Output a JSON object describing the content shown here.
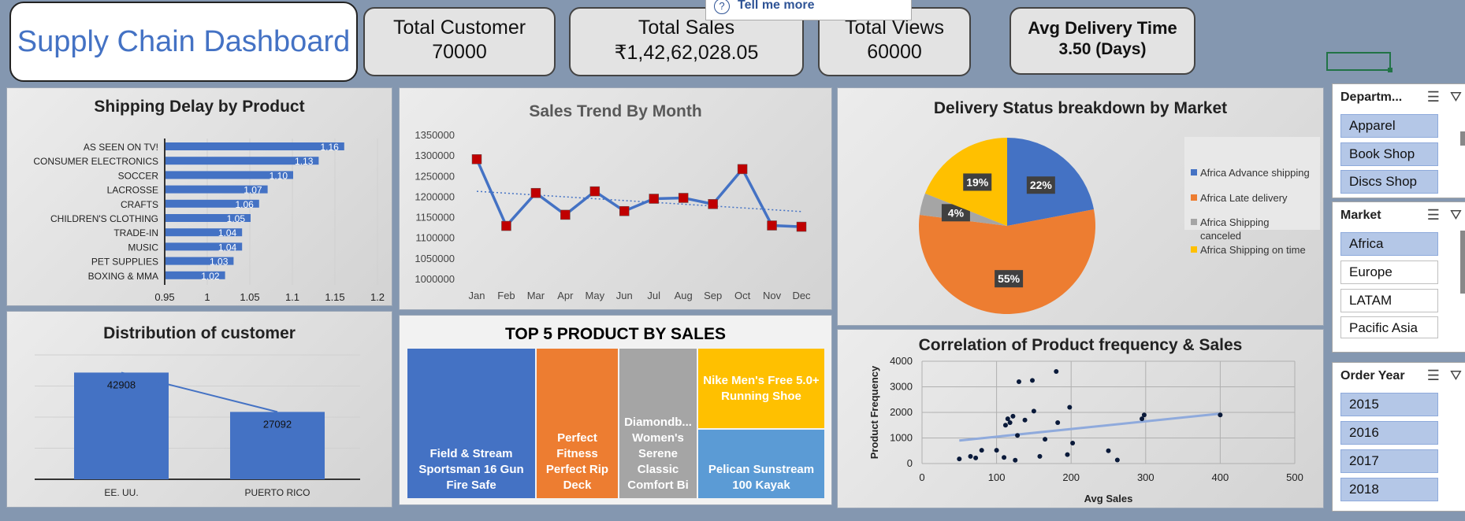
{
  "header": {
    "title": "Supply Chain Dashboard",
    "tell_me": "Tell me more"
  },
  "kpis": [
    {
      "label": "Total Customer",
      "value": "70000"
    },
    {
      "label": "Total Sales",
      "value": "₹1,42,62,028.05"
    },
    {
      "label": "Total Views",
      "value": "60000"
    },
    {
      "label": "Avg Delivery Time",
      "value": "3.50 (Days)"
    }
  ],
  "charts": {
    "shipping": {
      "title": "Shipping Delay by Product"
    },
    "sales": {
      "title": "Sales Trend By Month"
    },
    "delivery": {
      "title": "Delivery Status breakdown by Market"
    },
    "distribution": {
      "title": "Distribution of customer"
    },
    "top5": {
      "title": "TOP 5 PRODUCT BY SALES"
    },
    "correlation": {
      "title": "Correlation of Product frequency & Sales",
      "xlabel": "Avg Sales",
      "ylabel": "Product Frequency"
    }
  },
  "chart_data": [
    {
      "type": "bar",
      "orientation": "horizontal",
      "title": "Shipping Delay by Product",
      "categories": [
        "AS SEEN ON  TV!",
        "CONSUMER ELECTRONICS",
        "SOCCER",
        "LACROSSE",
        "CRAFTS",
        "CHILDREN'S CLOTHING",
        "TRADE-IN",
        "MUSIC",
        "PET SUPPLIES",
        "BOXING & MMA"
      ],
      "values": [
        1.16,
        1.13,
        1.1,
        1.07,
        1.06,
        1.05,
        1.04,
        1.04,
        1.03,
        1.02
      ],
      "labels": [
        "1.16",
        "1.13",
        "1.10",
        "1.07",
        "1.06",
        "1.05",
        "1.04",
        "1.04",
        "1.03",
        "1.02"
      ],
      "xlim": [
        0.95,
        1.2
      ],
      "xticks": [
        "0.95",
        "1",
        "1.05",
        "1.1",
        "1.15",
        "1.2"
      ],
      "grid": true,
      "color": "#4472c4"
    },
    {
      "type": "line",
      "title": "Sales Trend By Month",
      "categories": [
        "Jan",
        "Feb",
        "Mar",
        "Apr",
        "May",
        "Jun",
        "Jul",
        "Aug",
        "Sep",
        "Oct",
        "Nov",
        "Dec"
      ],
      "values": [
        1292000,
        1130000,
        1210000,
        1157000,
        1214000,
        1166000,
        1196000,
        1198000,
        1183000,
        1268000,
        1131000,
        1128000
      ],
      "ylim": [
        1000000,
        1350000
      ],
      "yticks": [
        "1000000",
        "1050000",
        "1100000",
        "1150000",
        "1200000",
        "1250000",
        "1300000",
        "1350000"
      ],
      "trendline": true,
      "line_color": "#4472c4",
      "marker_color": "#c00000"
    },
    {
      "type": "pie",
      "title": "Delivery Status breakdown by Market",
      "slices": [
        {
          "name": "Africa Advance shipping",
          "value": 22,
          "label": "22%",
          "color": "#4472c4"
        },
        {
          "name": "Africa Late delivery",
          "value": 55,
          "label": "55%",
          "color": "#ed7d31"
        },
        {
          "name": "Africa Shipping canceled",
          "value": 4,
          "label": "4%",
          "color": "#a5a5a5"
        },
        {
          "name": "Africa Shipping on time",
          "value": 19,
          "label": "19%",
          "color": "#ffc000"
        }
      ],
      "legend_placement": "right"
    },
    {
      "type": "bar",
      "title": "Distribution of customer",
      "categories": [
        "EE. UU.",
        "PUERTO RICO"
      ],
      "values": [
        42908,
        27092
      ],
      "labels": [
        "42908",
        "27092"
      ],
      "trendline": true,
      "color": "#4472c4"
    },
    {
      "type": "treemap",
      "title": "TOP 5 PRODUCT BY SALES",
      "items": [
        {
          "name": "Field & Stream Sportsman 16 Gun Fire Safe",
          "color": "#4472c4"
        },
        {
          "name": "Perfect Fitness Perfect Rip Deck",
          "color": "#ed7d31"
        },
        {
          "name": "Diamondb... Women's Serene Classic Comfort Bi",
          "color": "#a5a5a5"
        },
        {
          "name": "Nike Men's Free 5.0+ Running Shoe",
          "color": "#ffc000"
        },
        {
          "name": "Pelican Sunstream 100 Kayak",
          "color": "#5b9bd5"
        }
      ]
    },
    {
      "type": "scatter",
      "title": "Correlation of Product frequency & Sales",
      "xlabel": "Avg Sales",
      "ylabel": "Product Frequency",
      "xlim": [
        0,
        500
      ],
      "ylim": [
        0,
        4000
      ],
      "xticks": [
        "0",
        "100",
        "200",
        "300",
        "400",
        "500"
      ],
      "yticks": [
        "0",
        "1000",
        "2000",
        "3000",
        "4000"
      ],
      "trendline": {
        "x": [
          50,
          400
        ],
        "y": [
          900,
          1950
        ]
      },
      "points": [
        [
          50,
          180
        ],
        [
          65,
          280
        ],
        [
          72,
          220
        ],
        [
          80,
          520
        ],
        [
          100,
          520
        ],
        [
          110,
          240
        ],
        [
          112,
          1500
        ],
        [
          115,
          1750
        ],
        [
          118,
          1600
        ],
        [
          122,
          1850
        ],
        [
          125,
          130
        ],
        [
          128,
          1100
        ],
        [
          130,
          3200
        ],
        [
          138,
          1700
        ],
        [
          148,
          3250
        ],
        [
          150,
          2050
        ],
        [
          158,
          280
        ],
        [
          165,
          950
        ],
        [
          180,
          3600
        ],
        [
          182,
          1600
        ],
        [
          195,
          350
        ],
        [
          198,
          2200
        ],
        [
          202,
          800
        ],
        [
          250,
          500
        ],
        [
          262,
          140
        ],
        [
          295,
          1750
        ],
        [
          298,
          1900
        ],
        [
          400,
          1900
        ]
      ]
    }
  ],
  "slicers": {
    "department": {
      "header": "Departm...",
      "items": [
        {
          "label": "Apparel",
          "selected": true
        },
        {
          "label": "Book Shop",
          "selected": true
        },
        {
          "label": "Discs Shop",
          "selected": true
        }
      ]
    },
    "market": {
      "header": "Market",
      "items": [
        {
          "label": "Africa",
          "selected": true
        },
        {
          "label": "Europe",
          "selected": false
        },
        {
          "label": "LATAM",
          "selected": false
        },
        {
          "label": "Pacific Asia",
          "selected": false
        }
      ]
    },
    "order_year": {
      "header": "Order Year",
      "items": [
        {
          "label": "2015",
          "selected": true
        },
        {
          "label": "2016",
          "selected": true
        },
        {
          "label": "2017",
          "selected": true
        },
        {
          "label": "2018",
          "selected": true
        }
      ]
    }
  }
}
